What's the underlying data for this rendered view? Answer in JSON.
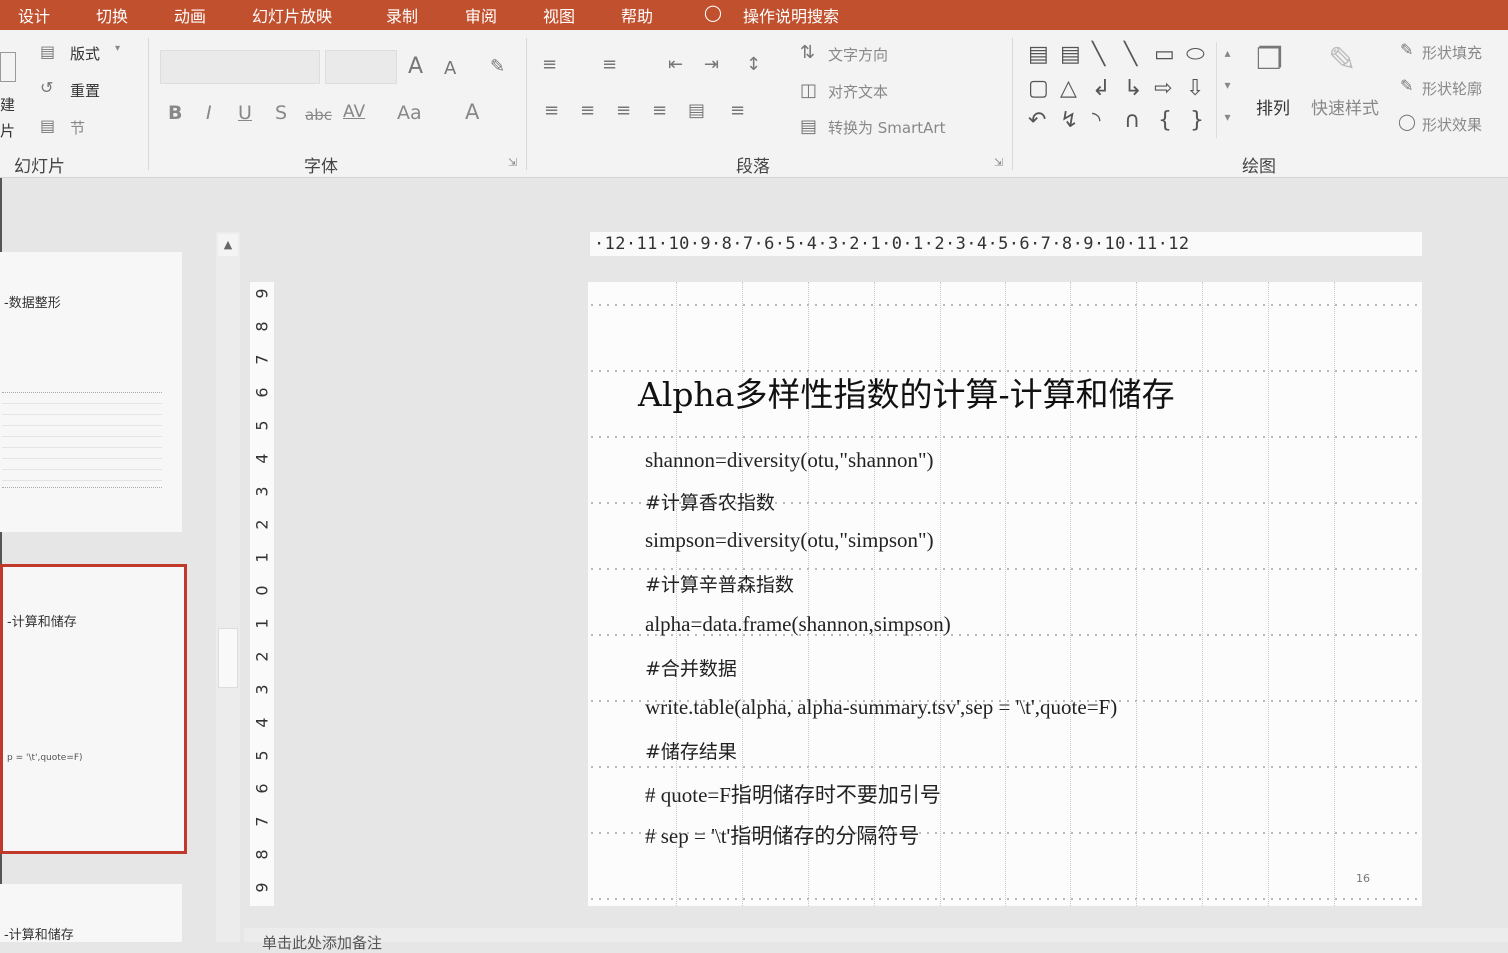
{
  "menubar": {
    "items": [
      "设计",
      "切换",
      "动画",
      "幻灯片放映",
      "录制",
      "审阅",
      "视图",
      "帮助"
    ],
    "search_label": "操作说明搜索"
  },
  "ribbon": {
    "slides_group": {
      "label": "幻灯片",
      "layout": "版式",
      "reset": "重置",
      "section": "节",
      "new_slide_fragment": "建",
      "new_slide_fragment2": "片"
    },
    "font_group": {
      "label": "字体",
      "bold": "B",
      "italic": "I",
      "underline": "U",
      "shadow": "S",
      "strike": "abc",
      "spacing": "AV",
      "case": "Aa",
      "color": "A",
      "grow": "A",
      "shrink": "A"
    },
    "paragraph_group": {
      "label": "段落",
      "text_direction": "文字方向",
      "align_text": "对齐文本",
      "smartart": "转换为 SmartArt"
    },
    "drawing_group": {
      "label": "绘图",
      "arrange": "排列",
      "quick_styles": "快速样式",
      "shape_fill": "形状填充",
      "shape_outline": "形状轮廓",
      "shape_effects": "形状效果"
    }
  },
  "thumbnails": [
    {
      "title": "-数据整形"
    },
    {
      "title": "-计算和储存",
      "detail": "p = '\\t',quote=F)",
      "active": true
    },
    {
      "title": "-计算和储存"
    }
  ],
  "rulers": {
    "horizontal": "·12·11·10·9·8·7·6·5·4·3·2·1·0·1·2·3·4·5·6·7·8·9·10·11·12",
    "vertical": [
      "9",
      "8",
      "7",
      "6",
      "5",
      "4",
      "3",
      "2",
      "1",
      "0",
      "1",
      "2",
      "3",
      "4",
      "5",
      "6",
      "7",
      "8",
      "9"
    ]
  },
  "slide": {
    "title": "Alpha多样性指数的计算-计算和储存",
    "lines": [
      "shannon=diversity(otu,\"shannon\")",
      "#计算香农指数",
      "simpson=diversity(otu,\"simpson\")",
      "#计算辛普森指数",
      "alpha=data.frame(shannon,simpson)",
      "#合并数据",
      "write.table(alpha, alpha-summary.tsv',sep = '\\t',quote=F)",
      "#储存结果",
      "# quote=F指明储存时不要加引号",
      "# sep = '\\t'指明储存的分隔符号"
    ],
    "page_number": "16"
  },
  "notes": {
    "placeholder": "单击此处添加备注"
  },
  "colors": {
    "accent": "#c1502e",
    "selection": "#c1392b"
  }
}
